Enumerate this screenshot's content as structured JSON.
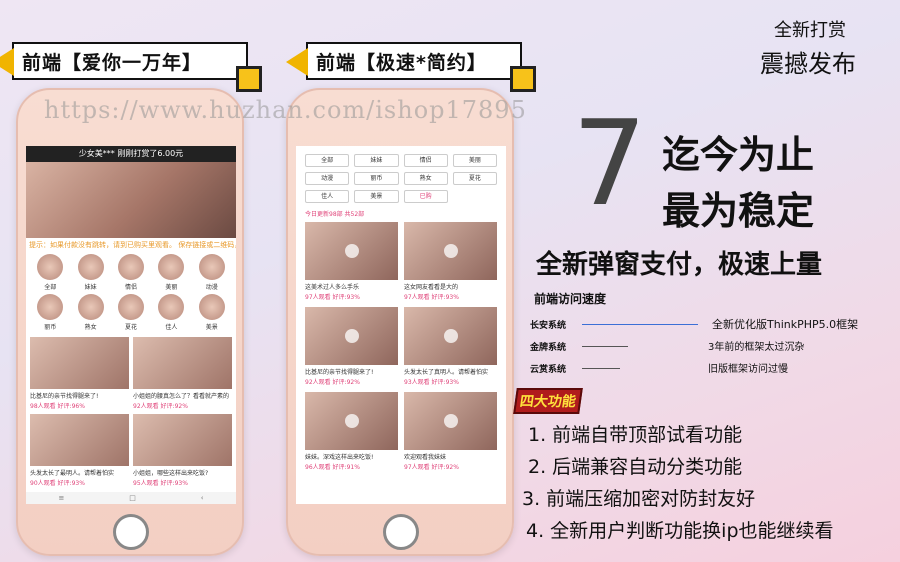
{
  "tags": {
    "left": "前端【爱你一万年】",
    "middle": "前端【极速*简约】"
  },
  "watermark": "https://www.huzhan.com/ishop17895",
  "corner": {
    "line1": "全新打赏",
    "line2": "震撼发布"
  },
  "headline": {
    "number": "7",
    "line1": "迄今为止",
    "line2": "最为稳定",
    "sub": "全新弹窗支付，极速上量"
  },
  "speed": {
    "title": "前端访问速度",
    "rows": [
      {
        "name": "长安系统",
        "desc": "全新优化版ThinkPHP5.0框架",
        "color": "#3b6fd6"
      },
      {
        "name": "金牌系统",
        "desc": "3年前的框架太过沉杂",
        "color": "#555555"
      },
      {
        "name": "云赏系统",
        "desc": "旧版框架访问过慢",
        "color": "#555555"
      }
    ]
  },
  "features": {
    "badge": "四大功能",
    "items": [
      "1. 前端自带顶部试看功能",
      "2. 后端兼容自动分类功能",
      "3. 前端压缩加密对防封友好",
      "4. 全新用户判断功能换ip也能继续看"
    ]
  },
  "phone1": {
    "topbar": "少女美*** 刚刚打赏了6.00元",
    "marquee": "提示：如果付款没有跳转，请到已购买里观看。 保存链接或二维码，",
    "cats": [
      "全部",
      "妹妹",
      "情侣",
      "美丽",
      "动漫",
      "丽币",
      "熟女",
      "夏花",
      "佳人",
      "美景"
    ],
    "cards": [
      {
        "title": "比基尼的亲节找得腿来了!",
        "meta": "98人观看  好评:96%"
      },
      {
        "title": "小姐姐的腰真怎么了？看看就产素的",
        "meta": "92人观看  好评:92%"
      },
      {
        "title": "头发太长了最明人。请帮着怕实",
        "meta": "90人观看  好评:93%"
      },
      {
        "title": "小姐姐，哪些这样出来吃饭?",
        "meta": "95人观看  好评:93%"
      }
    ]
  },
  "phone2": {
    "filters": [
      "全部",
      "妹妹",
      "情侣",
      "美丽",
      "动漫",
      "丽币",
      "熟女",
      "夏花",
      "佳人",
      "美景",
      "已购"
    ],
    "rec": "今日更新98部  共52部",
    "cards": [
      {
        "title": "这美术过人多么手乐",
        "meta": "97人观看  好评:93%"
      },
      {
        "title": "这女网友看看是大的",
        "meta": "97人观看  好评:93%"
      },
      {
        "title": "比基尼的亲节找得腿来了!",
        "meta": "92人观看  好评:92%"
      },
      {
        "title": "头发太长了真明人。请帮着怕实",
        "meta": "93人观看  好评:93%"
      },
      {
        "title": "妹妹。深戏这样出来吃饭!",
        "meta": "96人观看  好评:91%"
      },
      {
        "title": "欢迎观看我妹妹",
        "meta": "97人观看  好评:92%"
      }
    ]
  }
}
